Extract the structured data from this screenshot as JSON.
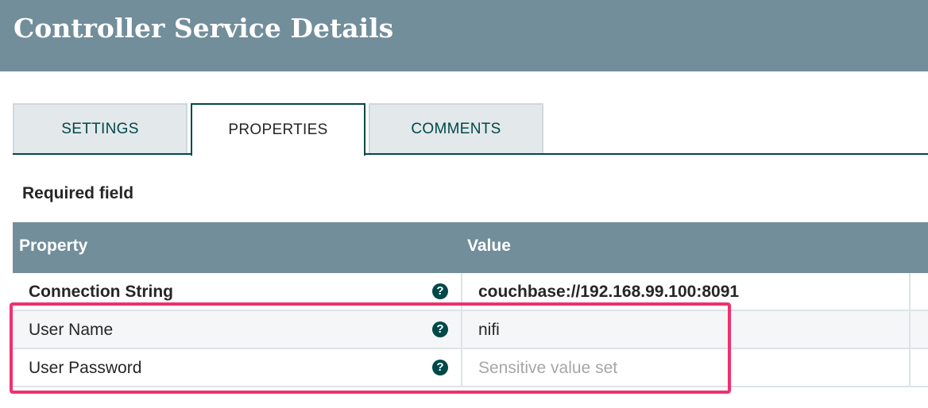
{
  "header": {
    "title": "Controller Service Details"
  },
  "tabs": [
    {
      "label": "SETTINGS",
      "active": false
    },
    {
      "label": "PROPERTIES",
      "active": true
    },
    {
      "label": "COMMENTS",
      "active": false
    }
  ],
  "required_label": "Required field",
  "grid": {
    "columns": {
      "property": "Property",
      "value": "Value"
    },
    "rows": [
      {
        "property": "Connection String",
        "value": "couchbase://192.168.99.100:8091",
        "required": true,
        "help_icon": "question-circle-icon"
      },
      {
        "property": "User Name",
        "value": "nifi",
        "required": false,
        "help_icon": "question-circle-icon"
      },
      {
        "property": "User Password",
        "value": "Sensitive value set",
        "required": false,
        "help_icon": "question-circle-icon"
      }
    ]
  },
  "colors": {
    "header_bg": "#728e9b",
    "accent": "#004849",
    "highlight": "#f0316e"
  }
}
